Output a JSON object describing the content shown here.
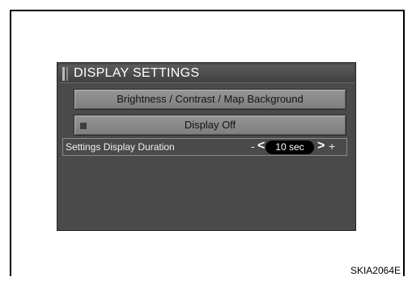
{
  "title": "DISPLAY SETTINGS",
  "buttons": {
    "brightness": "Brightness / Contrast / Map Background",
    "display_off": "Display Off"
  },
  "duration_row": {
    "label": "Settings Display Duration",
    "minus": "-",
    "left_arrow": "<",
    "value": "10 sec",
    "right_arrow": ">",
    "plus": "+"
  },
  "figure_code": "SKIA2064E",
  "icons": {
    "indicator": "square-indicator-icon"
  }
}
